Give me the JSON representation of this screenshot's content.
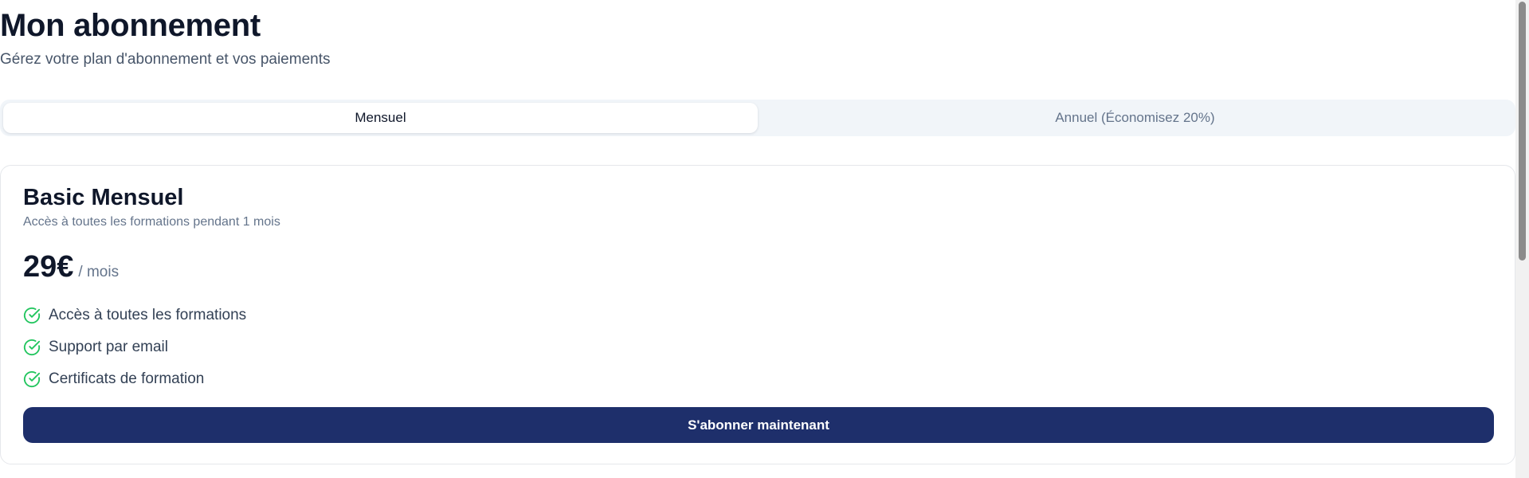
{
  "header": {
    "title": "Mon abonnement",
    "subtitle": "Gérez votre plan d'abonnement et vos paiements"
  },
  "billing_toggle": {
    "options": [
      {
        "label": "Mensuel",
        "selected": true
      },
      {
        "label": "Annuel (Économisez 20%)",
        "selected": false
      }
    ]
  },
  "plan": {
    "name": "Basic Mensuel",
    "description": "Accès à toutes les formations pendant 1 mois",
    "price": "29€",
    "period": "/ mois",
    "features": [
      {
        "label": "Accès à toutes les formations",
        "icon": "check-circle-icon"
      },
      {
        "label": "Support par email",
        "icon": "check-circle-icon"
      },
      {
        "label": "Certificats de formation",
        "icon": "check-circle-icon"
      }
    ],
    "cta_label": "S'abonner maintenant"
  },
  "colors": {
    "primary": "#1e2f6b",
    "check": "#22c55e",
    "text_dark": "#0f172a",
    "text_muted": "#64748b",
    "toggle_bg": "#f1f5f9"
  }
}
